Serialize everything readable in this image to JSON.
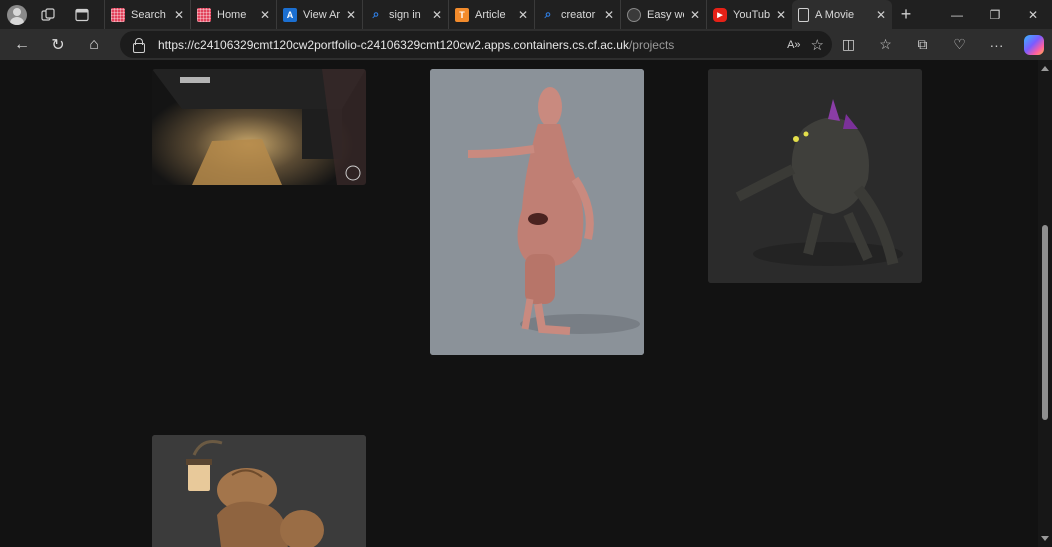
{
  "tabs": [
    {
      "label": "Search",
      "favicon": "grid-favicon-icon",
      "color": "#e2435c",
      "active": false,
      "width": 86
    },
    {
      "label": "Home",
      "favicon": "grid-favicon-icon",
      "color": "#e2435c",
      "active": false,
      "width": 86
    },
    {
      "label": "View Ar",
      "favicon": "a-favicon-icon",
      "color": "#1b6fd1",
      "active": false,
      "width": 86
    },
    {
      "label": "sign in",
      "favicon": "search-favicon-icon",
      "color": "#2f7de1",
      "active": false,
      "width": 86
    },
    {
      "label": "Article",
      "favicon": "t-favicon-icon",
      "color": "#f28b2c",
      "active": false,
      "width": 86
    },
    {
      "label": "creator",
      "favicon": "search-favicon-icon",
      "color": "#2f7de1",
      "active": false,
      "width": 86
    },
    {
      "label": "Easy we",
      "favicon": "circle-favicon-icon",
      "color": "#3a3a3a",
      "active": false,
      "width": 86
    },
    {
      "label": "YouTub",
      "favicon": "youtube-favicon-icon",
      "color": "#e62117",
      "active": false,
      "width": 86
    },
    {
      "label": "A Movie",
      "favicon": "page-favicon-icon",
      "color": "#2e2e2e",
      "active": true,
      "width": 86
    }
  ],
  "address": {
    "domain": "https://c24106329cmt120cw2portfolio-c24106329cmt120cw2.apps.containers.cs.cf.ac.uk",
    "path": "/projects"
  },
  "icons": {
    "newtab": "+",
    "minimize": "—",
    "restore": "❐",
    "close": "✕",
    "back": "←",
    "refresh": "↻",
    "home": "⌂",
    "read_aloud": "A»",
    "favorite": "☆",
    "split": "◫",
    "favorites": "☆",
    "collections": "⧉",
    "health": "♡",
    "more": "···"
  },
  "colors": {
    "page_bg": "#121212",
    "tabbar_bg": "#202020",
    "toolbar_bg": "#2e2e2e"
  }
}
